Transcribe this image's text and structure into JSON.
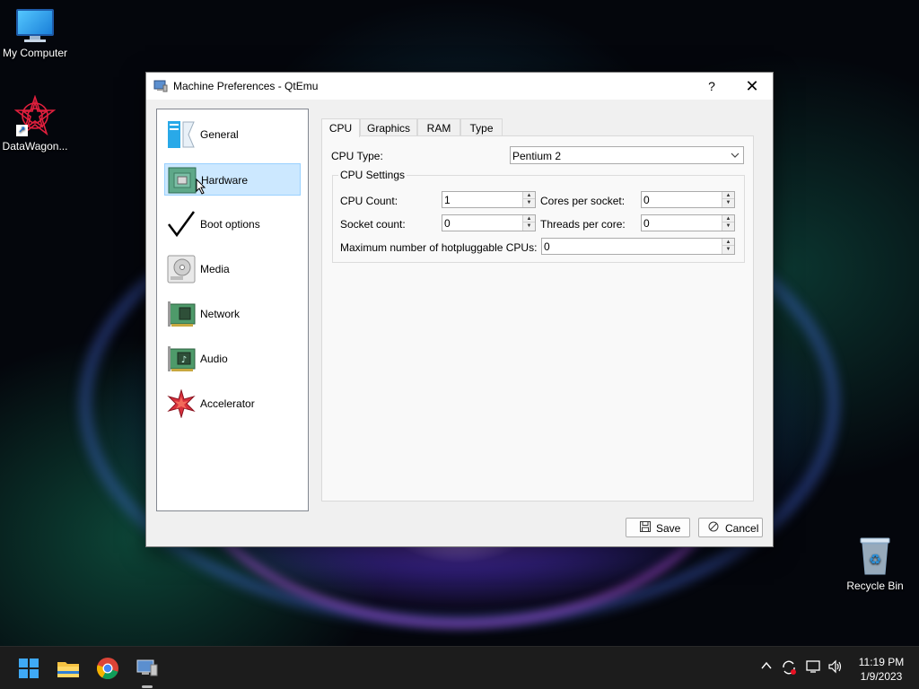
{
  "desktop": {
    "icons": [
      {
        "label": "My Computer",
        "icon": "monitor-icon"
      },
      {
        "label": "DataWagon...",
        "icon": "star-burst-icon"
      },
      {
        "label": "Recycle Bin",
        "icon": "recycle-bin-icon"
      }
    ]
  },
  "dialog": {
    "title": "Machine Preferences - QtEmu",
    "help_label": "?",
    "close_label": "✕",
    "nav": [
      {
        "label": "General",
        "icon": "general-icon"
      },
      {
        "label": "Hardware",
        "icon": "hardware-icon",
        "selected": true
      },
      {
        "label": "Boot options",
        "icon": "checkmark-icon"
      },
      {
        "label": "Media",
        "icon": "media-icon"
      },
      {
        "label": "Network",
        "icon": "network-icon"
      },
      {
        "label": "Audio",
        "icon": "audio-icon"
      },
      {
        "label": "Accelerator",
        "icon": "accelerator-icon"
      }
    ],
    "tabs": [
      "CPU",
      "Graphics",
      "RAM",
      "Type"
    ],
    "active_tab": "CPU",
    "cpu": {
      "cpu_type_label": "CPU Type:",
      "cpu_type_value": "Pentium 2",
      "group_title": "CPU Settings",
      "cpu_count_label": "CPU Count:",
      "cpu_count_value": "1",
      "cores_label": "Cores per socket:",
      "cores_value": "0",
      "socket_label": "Socket count:",
      "socket_value": "0",
      "threads_label": "Threads per core:",
      "threads_value": "0",
      "maxhot_label": "Maximum number of hotpluggable CPUs:",
      "maxhot_value": "0"
    },
    "buttons": {
      "save": "Save",
      "cancel": "Cancel"
    }
  },
  "taskbar": {
    "apps": [
      "start-icon",
      "file-explorer-icon",
      "chrome-icon",
      "qtemu-icon"
    ],
    "tray": [
      "chevron-up-icon",
      "sync-icon",
      "network-icon",
      "volume-icon"
    ],
    "time": "11:19 PM",
    "date": "1/9/2023"
  },
  "colors": {
    "selection_bg": "#cce8ff",
    "selection_border": "#99d1ff",
    "taskbar_bg": "#1c1c1c"
  }
}
